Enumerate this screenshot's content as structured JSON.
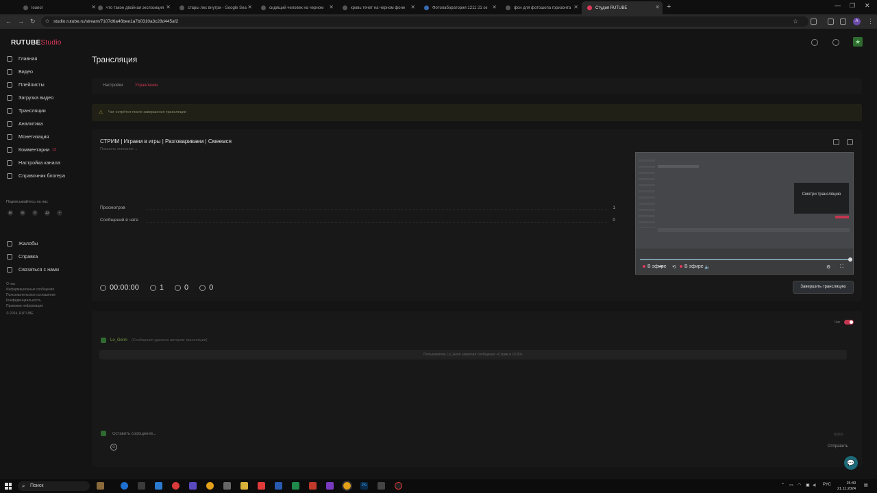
{
  "browser": {
    "tabs": [
      {
        "title": "lounol"
      },
      {
        "title": "что такое двойная экспозиция"
      },
      {
        "title": "стары лес внутри - Google Sea"
      },
      {
        "title": "сидящий человек на черном"
      },
      {
        "title": "кровь течет на черном фоне"
      },
      {
        "title": "Фотолаборатория 1211 21 ок"
      },
      {
        "title": "фон для фотошопа горизонта"
      },
      {
        "title": "Студия RUTUBE"
      }
    ],
    "new_tab": "+",
    "url": "studio.rutube.ru/stream/7107d6a46bee1a7b0310a3c28d445af2",
    "profile_letter": "А"
  },
  "app": {
    "logo_main": "RUTUBE",
    "logo_sub": "Studio"
  },
  "sidebar": {
    "items": [
      {
        "label": "Главная"
      },
      {
        "label": "Видео"
      },
      {
        "label": "Плейлисты"
      },
      {
        "label": "Загрузка видео"
      },
      {
        "label": "Трансляции"
      },
      {
        "label": "Аналитика"
      },
      {
        "label": "Монетизация"
      },
      {
        "label": "Комментарии",
        "badge": "13"
      },
      {
        "label": "Настройка канала"
      },
      {
        "label": "Справочник блогера"
      }
    ],
    "follow_label": "Подписывайтесь на нас",
    "social": [
      "вк",
      "ок",
      "тг",
      "дз",
      "+"
    ],
    "bottom_items": [
      {
        "label": "Жалобы"
      },
      {
        "label": "Справка"
      },
      {
        "label": "Связаться с нами"
      }
    ],
    "footer_links": [
      "О нас",
      "Информационные сообщения",
      "Пользовательское соглашение",
      "Конфиденциальность",
      "Правовая информация",
      "© 2024, RUTUBE"
    ]
  },
  "page": {
    "title": "Трансляция",
    "tabs": [
      {
        "label": "Настройки"
      },
      {
        "label": "Управление"
      }
    ],
    "warning": "Чат сотрётся после завершения трансляции"
  },
  "stream": {
    "title": "СТРИМ | Играем в игры | Разговариваем | Смеемся",
    "show_description": "Показать описание",
    "stats": [
      {
        "label": "Просмотров",
        "value": "1"
      },
      {
        "label": "Сообщений в чате",
        "value": "0"
      }
    ],
    "counters": {
      "duration": "00:00:00",
      "viewers": "1",
      "likes": "0",
      "dislikes": "0"
    },
    "player": {
      "overlay_text": "Смотри трансляцию",
      "live_label": "В эфире",
      "live_label2": "В эфире",
      "progress": 1.0
    },
    "finish_button": "Завершить трансляцию"
  },
  "chat": {
    "toggle_label": "Чат",
    "toggle_on": true,
    "messages": [
      {
        "author": "Lo_Genn",
        "text": "(Сообщение удалено автором трансляции)"
      }
    ],
    "system_message": "Пользователь Lo_Genn закрепил сообщение «Стрим в 15:00»",
    "input_placeholder": "Оставить сообщение...",
    "char_count": "0/200",
    "send_label": "Отправить"
  },
  "taskbar": {
    "search_placeholder": "Поиск",
    "tray_lang": "РУС",
    "time": "15:40",
    "date": "21.11.2024"
  },
  "colors": {
    "accent": "#e0395a",
    "background": "#141414",
    "panel": "#181818"
  }
}
